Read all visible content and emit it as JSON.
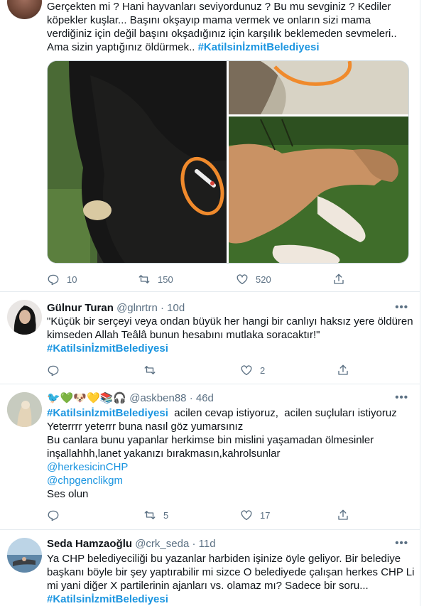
{
  "tweet1": {
    "text_lines": [
      "Gerçekten mi ? Hani hayvanları seviyordunuz ? Bu mu sevginiz ? Kediler",
      "köpekler kuşlar... Başını okşayıp mama vermek ve onların sizi mama",
      "verdiğiniz için değil başını okşadığınız için karşılık beklemeden sevmeleri..",
      "Ama sizin yaptığınız öldürmek.."
    ],
    "hashtag": "#KatilsinİzmitBelediyesi",
    "replies": "10",
    "retweets": "150",
    "likes": "520"
  },
  "tweet2": {
    "name": "Gülnur Turan",
    "handle": "@glnrtrn",
    "time": "10d",
    "text_lines": [
      "\"Küçük bir serçeyi veya ondan büyük her hangi bir canlıyı haksız yere öldüren",
      "kimseden Allah Teâlâ bunun hesabını mutlaka soracaktır!\""
    ],
    "hashtag": "#KatilsinİzmitBelediyesi",
    "replies": "",
    "retweets": "",
    "likes": "2"
  },
  "tweet3": {
    "name_emoji": "🐦💚🐶💛📚🎧",
    "handle": "@askben88",
    "time": "46d",
    "hashtag": "#KatilsinİzmitBelediyesi",
    "first_line_rest": "  acilen cevap istiyoruz,  acilen suçluları istiyoruz",
    "text_lines": [
      "Yeterrrr yeterrr buna nasıl göz yumarsınız",
      "Bu canlara bunu yapanlar herkimse bin mislini yaşamadan ölmesinler",
      "inşallahhh,lanet yakanızı bırakmasın,kahrolsunlar"
    ],
    "mention1": "@herkesicinCHP",
    "mention2": "@chpgenclikgm",
    "last_line": "Ses olun",
    "replies": "",
    "retweets": "5",
    "likes": "17"
  },
  "tweet4": {
    "name": "Seda Hamzaoğlu",
    "handle": "@crk_seda",
    "time": "11d",
    "text_lines": [
      "Ya CHP belediyeciliği bu yazanlar harbiden işinize öyle geliyor. Bir belediye",
      "başkanı böyle bir şey yaptırabilir mi sizce O belediyede çalışan herkes CHP Li",
      "mi yani diğer X partilerinin ajanları vs. olamaz mı? Sadece bir soru..."
    ],
    "hashtag": "#KatilsinİzmitBelediyesi"
  },
  "separator": "·",
  "more_label": "•••",
  "colors": {
    "link": "#1b95e0",
    "muted": "#5b7083",
    "border": "#e6ecf0"
  },
  "icons": [
    "reply-icon",
    "retweet-icon",
    "like-icon",
    "share-icon",
    "more-icon"
  ]
}
